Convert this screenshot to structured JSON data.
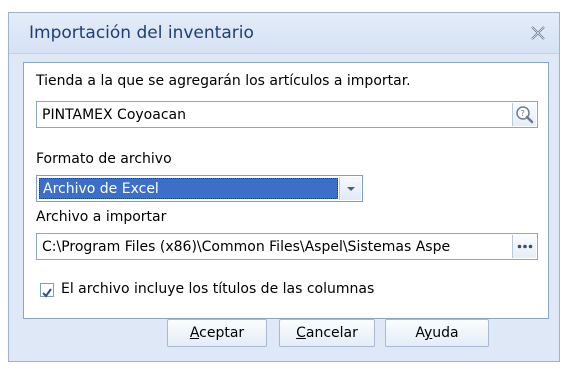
{
  "dialog": {
    "title": "Importación del inventario",
    "store_label": "Tienda a la que se agregarán los artículos a importar.",
    "store_value": "PINTAMEX Coyoacan",
    "format_label": "Formato de archivo",
    "format_value": "Archivo de Excel",
    "file_label": "Archivo a importar",
    "file_value": "C:\\Program Files (x86)\\Common Files\\Aspel\\Sistemas Aspe",
    "checkbox_label": "El archivo incluye los títulos de las columnas",
    "checkbox_checked": true,
    "buttons": {
      "accept": {
        "mnemonic": "A",
        "rest": "ceptar"
      },
      "cancel": {
        "mnemonic": "C",
        "rest": "ancelar"
      },
      "help": {
        "pre": "A",
        "mnemonic": "y",
        "rest": "uda"
      }
    }
  },
  "icons": {
    "close": "close-icon",
    "search": "search-icon",
    "dropdown": "chevron-down-icon",
    "browse": "ellipsis-icon",
    "check": "check-icon"
  }
}
